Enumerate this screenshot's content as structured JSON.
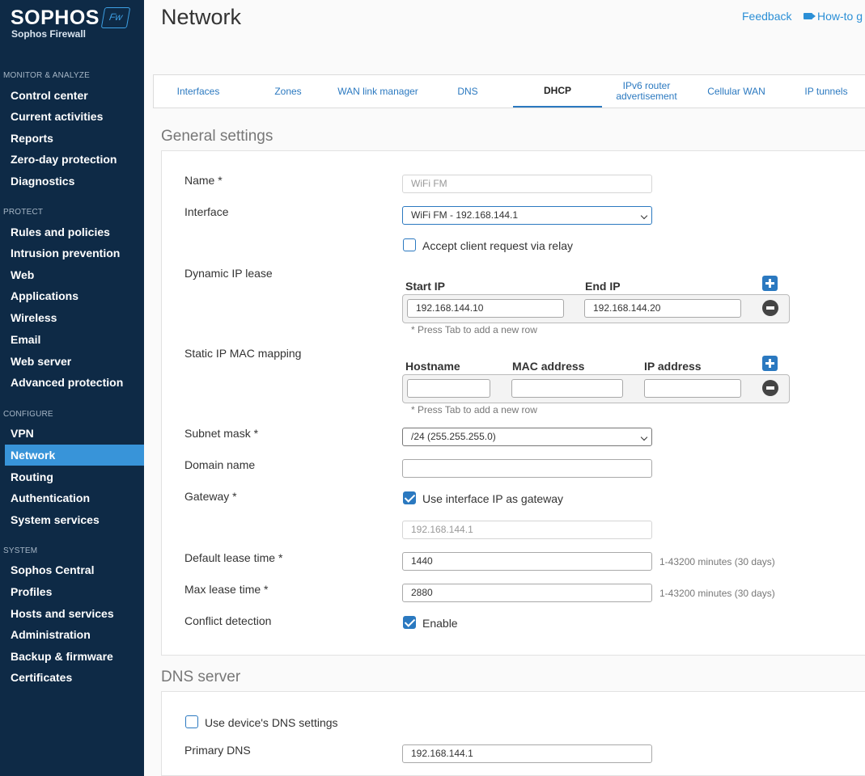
{
  "brand": {
    "name": "SOPHOS",
    "badge": "Fw",
    "product": "Sophos Firewall"
  },
  "sidebar": {
    "monitor": {
      "title": "MONITOR & ANALYZE",
      "items": [
        "Control center",
        "Current activities",
        "Reports",
        "Zero-day protection",
        "Diagnostics"
      ]
    },
    "protect": {
      "title": "PROTECT",
      "items": [
        "Rules and policies",
        "Intrusion prevention",
        "Web",
        "Applications",
        "Wireless",
        "Email",
        "Web server",
        "Advanced protection"
      ]
    },
    "configure": {
      "title": "CONFIGURE",
      "items": [
        "VPN",
        "Network",
        "Routing",
        "Authentication",
        "System services"
      ]
    },
    "system": {
      "title": "SYSTEM",
      "items": [
        "Sophos Central",
        "Profiles",
        "Hosts and services",
        "Administration",
        "Backup & firmware",
        "Certificates"
      ]
    },
    "active_item": "Network"
  },
  "header": {
    "title": "Network",
    "feedback": "Feedback",
    "howto": "How-to g"
  },
  "tabs": [
    {
      "label": "Interfaces"
    },
    {
      "label": "Zones"
    },
    {
      "label": "WAN link manager"
    },
    {
      "label": "DNS"
    },
    {
      "label": "DHCP",
      "active": true
    },
    {
      "label": "IPv6 router advertisement"
    },
    {
      "label": "Cellular WAN"
    },
    {
      "label": "IP tunnels"
    }
  ],
  "general": {
    "title": "General settings",
    "name_label": "Name *",
    "name_value": "WiFi FM",
    "interface_label": "Interface",
    "interface_value": "WiFi FM - 192.168.144.1",
    "relay_label": "Accept client request via relay",
    "lease_label": "Dynamic IP lease",
    "lease_start_header": "Start IP",
    "lease_end_header": "End IP",
    "lease_start": "192.168.144.10",
    "lease_end": "192.168.144.20",
    "tab_hint": "* Press Tab to add a new row",
    "static_label": "Static IP MAC mapping",
    "static_hostname_header": "Hostname",
    "static_mac_header": "MAC address",
    "static_ip_header": "IP address",
    "subnet_label": "Subnet mask *",
    "subnet_value": "/24 (255.255.255.0)",
    "domain_label": "Domain name",
    "domain_value": "",
    "gateway_label": "Gateway *",
    "gateway_check_label": "Use interface IP as gateway",
    "gateway_value": "192.168.144.1",
    "default_lease_label": "Default lease time *",
    "default_lease_value": "1440",
    "default_lease_range": "1-43200 minutes (30 days)",
    "max_lease_label": "Max lease time *",
    "max_lease_value": "2880",
    "max_lease_range": "1-43200 minutes (30 days)",
    "conflict_label": "Conflict detection",
    "conflict_check_label": "Enable"
  },
  "dns": {
    "title": "DNS server",
    "use_device_label": "Use device's DNS settings",
    "primary_label": "Primary DNS",
    "primary_value": "192.168.144.1"
  },
  "colors": {
    "sidebar_bg": "#0e2a46",
    "accent": "#3894d9",
    "link": "#2b79c0"
  }
}
